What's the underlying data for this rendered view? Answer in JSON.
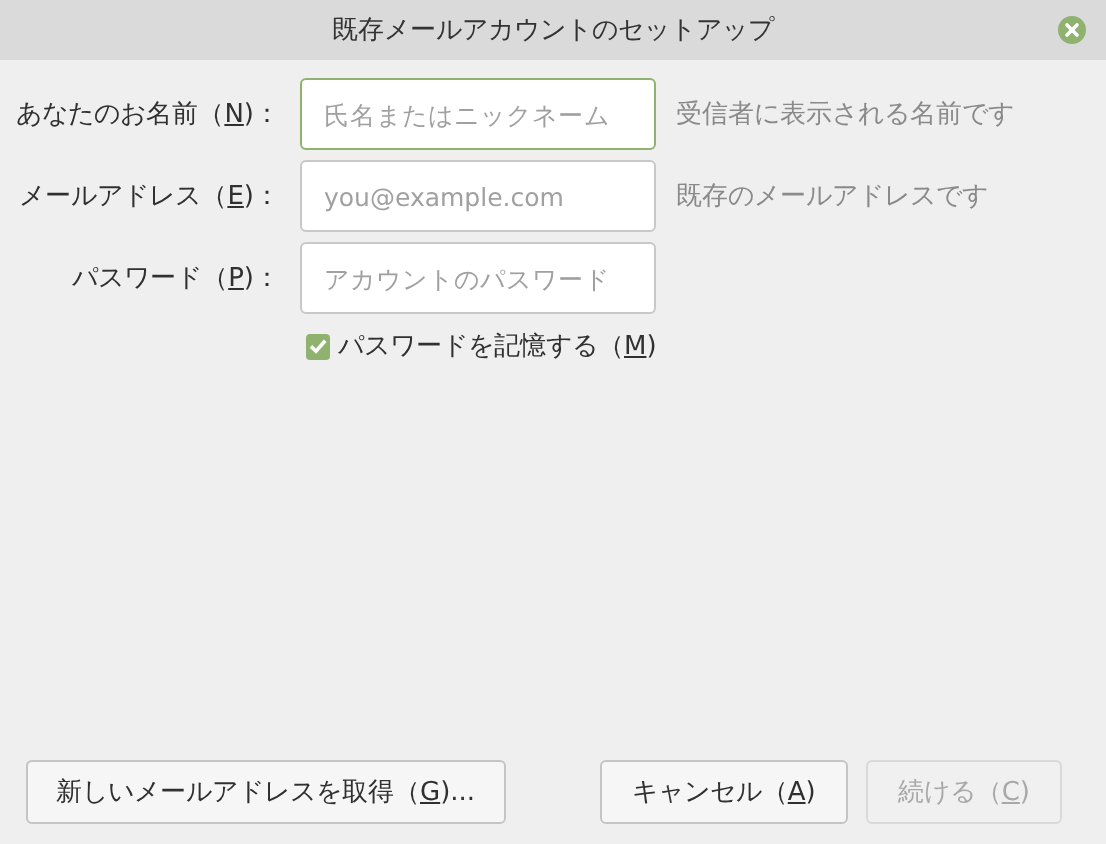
{
  "window": {
    "title": "既存メールアカウントのセットアップ"
  },
  "fields": [
    {
      "label_start": "あなたのお名前（",
      "accesskey": "N",
      "label_end": ")：",
      "placeholder": "氏名またはニックネーム",
      "focused": true,
      "hint": "受信者に表示される名前です"
    },
    {
      "label_start": "メールアドレス（",
      "accesskey": "E",
      "label_end": ")：",
      "placeholder": "you@example.com",
      "focused": false,
      "hint": "既存のメールアドレスです"
    },
    {
      "label_start": "パスワード（",
      "accesskey": "P",
      "label_end": ")：",
      "placeholder": "アカウントのパスワード",
      "focused": false
    }
  ],
  "remember": {
    "label_start": "パスワードを記憶する（",
    "accesskey": "M",
    "label_end": ")",
    "checked": true
  },
  "buttons": [
    {
      "label_start": "新しいメールアドレスを取得（",
      "accesskey": "G",
      "label_end": ")...",
      "disabled": false
    },
    {
      "label_start": "キャンセル（",
      "accesskey": "A",
      "label_end": ")",
      "disabled": false
    },
    {
      "label_start": "続ける（",
      "accesskey": "C",
      "label_end": ")",
      "disabled": true
    }
  ]
}
